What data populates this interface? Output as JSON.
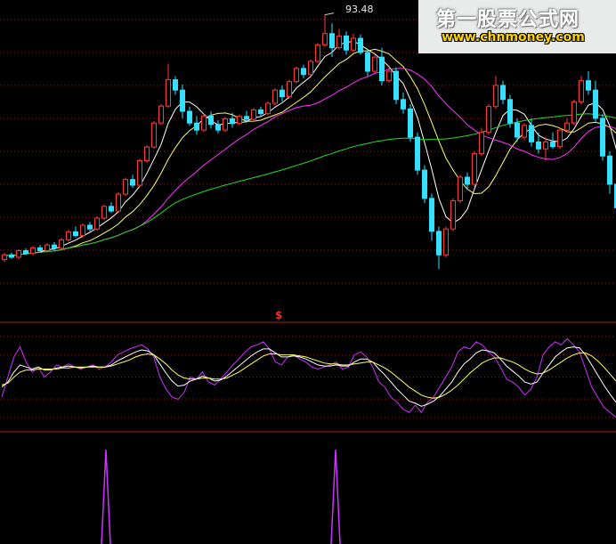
{
  "chart_data": {
    "type": "candlestick",
    "price_panel": {
      "ylim": [
        40,
        99
      ],
      "max_label": "93.48",
      "gridlines": [
        96,
        89,
        82,
        75,
        68,
        61,
        54,
        47,
        40
      ],
      "candles": [
        [
          45.0,
          46.4,
          44.5,
          46.0
        ],
        [
          46.0,
          46.5,
          45.2,
          45.5
        ],
        [
          45.5,
          47.2,
          45.1,
          46.9
        ],
        [
          46.9,
          47.4,
          46.0,
          46.3
        ],
        [
          46.3,
          47.9,
          45.9,
          47.5
        ],
        [
          47.5,
          48.1,
          46.5,
          46.9
        ],
        [
          46.9,
          48.5,
          46.5,
          48.1
        ],
        [
          48.1,
          48.7,
          47.0,
          47.4
        ],
        [
          47.4,
          49.6,
          47.0,
          49.2
        ],
        [
          49.2,
          51.3,
          48.8,
          50.9
        ],
        [
          50.9,
          52.0,
          49.7,
          50.1
        ],
        [
          50.1,
          52.7,
          49.7,
          52.3
        ],
        [
          52.3,
          53.0,
          51.0,
          51.5
        ],
        [
          51.5,
          54.2,
          51.1,
          53.8
        ],
        [
          53.8,
          56.7,
          53.4,
          56.3
        ],
        [
          56.3,
          57.2,
          54.9,
          55.3
        ],
        [
          55.3,
          59.3,
          54.9,
          58.9
        ],
        [
          58.9,
          62.4,
          58.5,
          62.0
        ],
        [
          62.0,
          63.0,
          60.2,
          60.8
        ],
        [
          60.8,
          66.4,
          60.4,
          66.0
        ],
        [
          66.0,
          69.3,
          65.6,
          68.9
        ],
        [
          68.9,
          74.4,
          68.5,
          74.0
        ],
        [
          74.0,
          78.0,
          73.6,
          77.6
        ],
        [
          77.6,
          86.6,
          77.2,
          83.2
        ],
        [
          83.2,
          84.0,
          80.0,
          81.0
        ],
        [
          81.0,
          82.2,
          75.0,
          76.5
        ],
        [
          76.5,
          77.5,
          73.4,
          74.0
        ],
        [
          74.0,
          75.5,
          71.5,
          72.5
        ],
        [
          72.5,
          75.9,
          72.1,
          75.5
        ],
        [
          75.5,
          76.5,
          72.8,
          73.7
        ],
        [
          73.7,
          74.6,
          71.8,
          72.5
        ],
        [
          72.5,
          75.3,
          72.1,
          74.9
        ],
        [
          74.9,
          76.2,
          73.0,
          73.9
        ],
        [
          73.9,
          75.8,
          73.5,
          75.4
        ],
        [
          75.4,
          76.6,
          74.0,
          74.8
        ],
        [
          74.8,
          77.2,
          74.4,
          76.8
        ],
        [
          76.8,
          77.5,
          75.3,
          76.0
        ],
        [
          76.0,
          78.6,
          75.6,
          78.2
        ],
        [
          78.2,
          81.4,
          77.8,
          81.0
        ],
        [
          81.0,
          82.0,
          78.6,
          79.6
        ],
        [
          79.6,
          83.2,
          79.2,
          82.8
        ],
        [
          82.8,
          86.0,
          82.4,
          85.6
        ],
        [
          85.6,
          86.4,
          83.5,
          84.3
        ],
        [
          84.3,
          87.5,
          83.9,
          87.1
        ],
        [
          87.1,
          91.0,
          86.7,
          90.6
        ],
        [
          90.6,
          97.0,
          90.2,
          93.0
        ],
        [
          93.0,
          95.2,
          88.0,
          90.0
        ],
        [
          90.0,
          94.0,
          89.6,
          92.5
        ],
        [
          92.5,
          93.48,
          88.5,
          89.5
        ],
        [
          89.5,
          93.0,
          89.1,
          92.0
        ],
        [
          92.0,
          92.8,
          88.5,
          89.0
        ],
        [
          89.0,
          89.8,
          84.0,
          85.0
        ],
        [
          85.0,
          88.5,
          84.6,
          88.0
        ],
        [
          88.0,
          90.0,
          82.0,
          83.0
        ],
        [
          83.0,
          86.0,
          82.6,
          85.0
        ],
        [
          85.0,
          85.8,
          78.0,
          79.0
        ],
        [
          79.0,
          80.5,
          76.0,
          77.0
        ],
        [
          77.0,
          78.0,
          70.0,
          71.0
        ],
        [
          71.0,
          72.0,
          63.0,
          64.0
        ],
        [
          64.0,
          65.0,
          57.0,
          58.0
        ],
        [
          58.0,
          59.0,
          49.0,
          51.0
        ],
        [
          51.0,
          52.0,
          43.0,
          46.0
        ],
        [
          46.0,
          52.0,
          45.5,
          51.5
        ],
        [
          51.5,
          58.0,
          51.0,
          57.5
        ],
        [
          57.5,
          63.0,
          57.0,
          62.5
        ],
        [
          62.5,
          63.5,
          60.0,
          61.0
        ],
        [
          61.0,
          68.0,
          60.5,
          67.5
        ],
        [
          67.5,
          73.0,
          67.0,
          72.0
        ],
        [
          72.0,
          78.0,
          71.5,
          77.5
        ],
        [
          77.5,
          84.0,
          77.0,
          82.0
        ],
        [
          82.0,
          83.0,
          78.0,
          79.0
        ],
        [
          79.0,
          80.0,
          73.0,
          74.0
        ],
        [
          74.0,
          75.0,
          70.0,
          71.0
        ],
        [
          71.0,
          74.0,
          70.5,
          73.5
        ],
        [
          73.5,
          75.0,
          69.0,
          70.0
        ],
        [
          70.0,
          72.0,
          67.5,
          68.5
        ],
        [
          68.5,
          71.0,
          66.0,
          70.0
        ],
        [
          70.0,
          72.0,
          68.5,
          69.0
        ],
        [
          69.0,
          73.0,
          68.5,
          72.5
        ],
        [
          72.5,
          75.0,
          72.0,
          74.0
        ],
        [
          74.0,
          79.0,
          73.5,
          78.5
        ],
        [
          78.5,
          84.0,
          78.0,
          83.0
        ],
        [
          83.0,
          85.0,
          80.0,
          81.0
        ],
        [
          81.0,
          83.0,
          74.0,
          75.0
        ],
        [
          75.0,
          76.0,
          66.0,
          67.0
        ],
        [
          67.0,
          68.0,
          59.0,
          61.0
        ],
        [
          61.0,
          62.0,
          52.0,
          56.0
        ]
      ],
      "ma_periods": [
        5,
        10,
        20,
        60
      ],
      "ma_colors": [
        "#ffffff",
        "#ffff66",
        "#ff33ff",
        "#22dd22"
      ]
    },
    "signal_label": "$",
    "oscillator_panel": {
      "ylim": [
        0,
        100
      ],
      "series": [
        {
          "color": "#cc33ff",
          "values": [
            30,
            50,
            70,
            80,
            65,
            55,
            60,
            50,
            55,
            62,
            60,
            63,
            60,
            58,
            60,
            62,
            58,
            60,
            65,
            72,
            75,
            78,
            80,
            82,
            78,
            70,
            50,
            38,
            30,
            28,
            35,
            50,
            48,
            55,
            45,
            42,
            48,
            55,
            62,
            68,
            75,
            80,
            82,
            85,
            78,
            65,
            62,
            70,
            72,
            68,
            65,
            60,
            58,
            60,
            62,
            65,
            58,
            60,
            72,
            75,
            70,
            60,
            45,
            40,
            30,
            25,
            18,
            15,
            22,
            15,
            25,
            30,
            40,
            50,
            60,
            75,
            80,
            78,
            85,
            82,
            75,
            70,
            60,
            48,
            45,
            40,
            32,
            38,
            50,
            72,
            80,
            85,
            82,
            88,
            82,
            75,
            58,
            40,
            30,
            20,
            15,
            10
          ]
        },
        {
          "color": "#ffffff",
          "values": [
            40,
            45,
            55,
            62,
            60,
            58,
            60,
            57,
            57,
            59,
            60,
            61,
            60,
            59,
            60,
            61,
            60,
            60,
            62,
            66,
            69,
            72,
            75,
            77,
            76,
            72,
            63,
            54,
            46,
            41,
            42,
            46,
            48,
            51,
            49,
            46,
            47,
            51,
            56,
            61,
            66,
            71,
            75,
            78,
            78,
            74,
            70,
            70,
            71,
            70,
            68,
            65,
            62,
            61,
            61,
            62,
            61,
            61,
            65,
            68,
            68,
            65,
            58,
            52,
            45,
            38,
            32,
            26,
            24,
            21,
            23,
            26,
            31,
            38,
            45,
            55,
            63,
            68,
            74,
            77,
            76,
            74,
            68,
            61,
            56,
            51,
            45,
            43,
            45,
            54,
            62,
            70,
            75,
            79,
            80,
            79,
            72,
            62,
            52,
            42,
            33,
            25
          ]
        },
        {
          "color": "#ffff66",
          "values": [
            42,
            44,
            50,
            55,
            57,
            57,
            58,
            58,
            58,
            58,
            59,
            59,
            60,
            60,
            60,
            60,
            60,
            60,
            61,
            63,
            65,
            67,
            70,
            72,
            73,
            72,
            68,
            63,
            57,
            52,
            49,
            48,
            48,
            49,
            49,
            48,
            48,
            49,
            52,
            55,
            59,
            63,
            67,
            71,
            73,
            73,
            72,
            72,
            72,
            71,
            70,
            68,
            66,
            64,
            63,
            63,
            62,
            62,
            63,
            64,
            65,
            65,
            62,
            59,
            55,
            50,
            45,
            40,
            36,
            32,
            30,
            29,
            30,
            33,
            37,
            42,
            48,
            54,
            59,
            64,
            67,
            69,
            69,
            67,
            65,
            62,
            58,
            55,
            53,
            54,
            57,
            61,
            65,
            69,
            72,
            74,
            74,
            71,
            66,
            60,
            53,
            46
          ]
        }
      ]
    },
    "spike_panel": {
      "ylim": [
        0,
        1
      ],
      "spikes_at_candle": [
        23,
        48
      ],
      "color": "#cc33ff"
    }
  },
  "watermark": {
    "title": "第一股票公式网",
    "url": "www.chnmoney.com"
  }
}
